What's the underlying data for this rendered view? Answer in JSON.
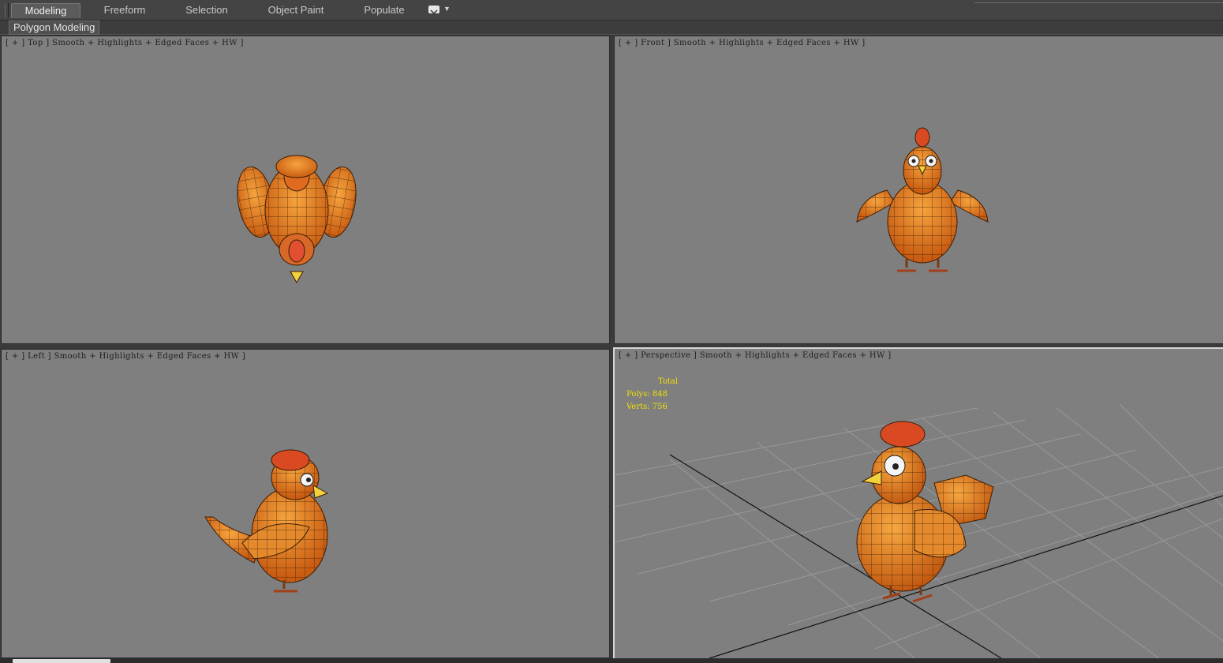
{
  "ribbon": {
    "tabs": [
      {
        "label": "Modeling",
        "active": true
      },
      {
        "label": "Freeform",
        "active": false
      },
      {
        "label": "Selection",
        "active": false
      },
      {
        "label": "Object Paint",
        "active": false
      },
      {
        "label": "Populate",
        "active": false
      }
    ],
    "panel_label": "Polygon Modeling"
  },
  "viewports": {
    "top": {
      "label": "[ + ] Top ] Smooth + Highlights + Edged Faces + HW ]"
    },
    "front": {
      "label": "[ + ] Front ] Smooth + Highlights + Edged Faces + HW ]"
    },
    "left": {
      "label": "[ + ] Left ] Smooth + Highlights + Edged Faces + HW ]"
    },
    "perspective": {
      "label": "[ + ] Perspective ] Smooth + Highlights + Edged Faces + HW ]",
      "stats": {
        "title": "Total",
        "polys": "Polys: 848",
        "verts": "Verts: 756"
      }
    }
  },
  "colors": {
    "viewport_bg": "#7f7f7f",
    "model_orange": "#e98a24",
    "model_dark": "#c05a10",
    "comb_red": "#d94a22",
    "beak_yellow": "#f2d23c",
    "stats_yellow": "#f0e000",
    "grid": "#999999"
  },
  "icons": [
    "dropdown-icon",
    "chevron-down-icon"
  ]
}
